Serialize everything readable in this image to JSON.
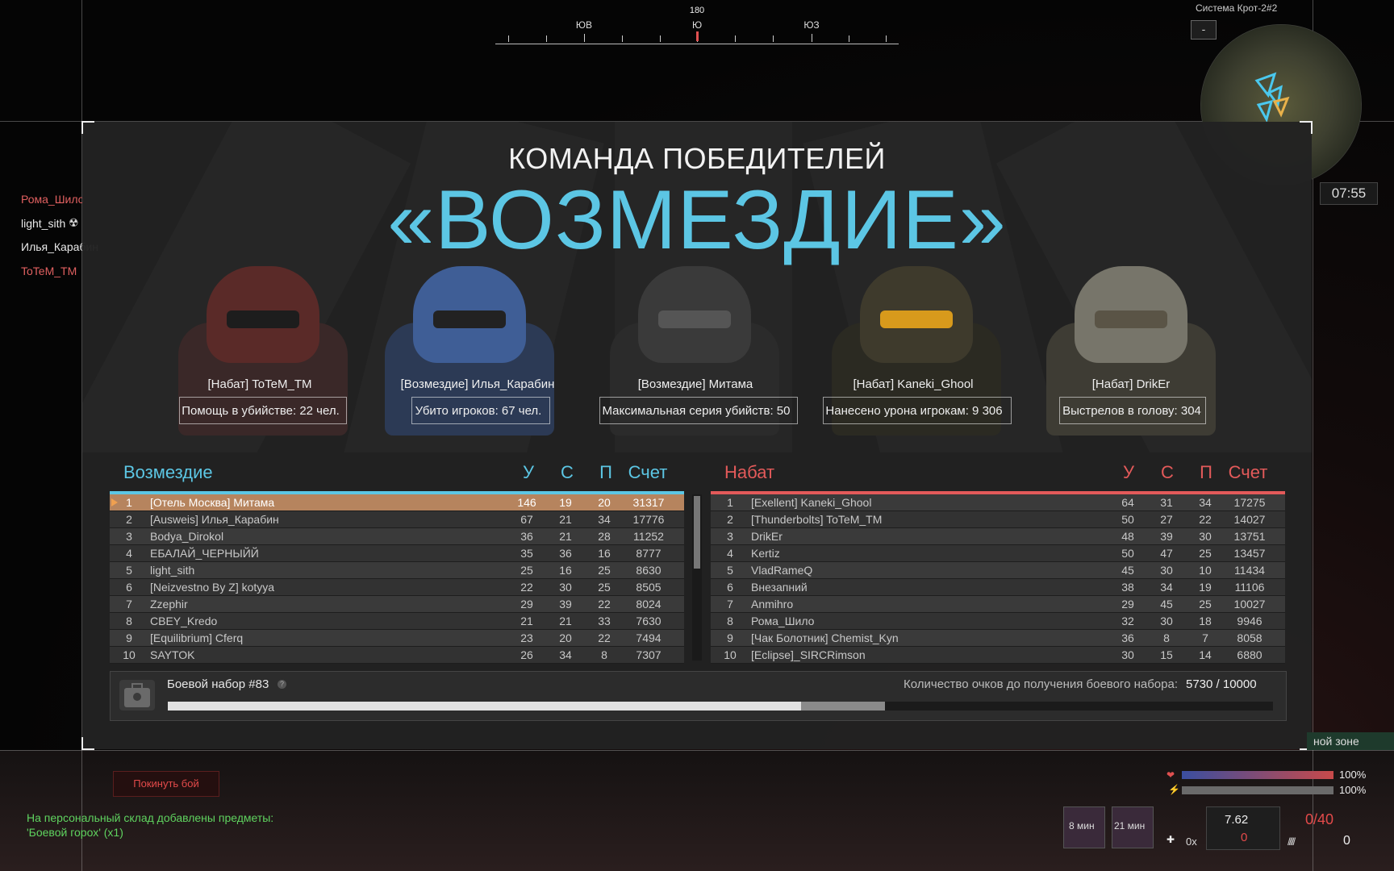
{
  "compass": {
    "degree": "180",
    "labels": [
      {
        "text": "ЮВ"
      },
      {
        "text": "Ю"
      },
      {
        "text": "ЮЗ"
      }
    ]
  },
  "minimap": {
    "title": "Система Крот-2#2",
    "zoom_label": "-",
    "clock": "07:55"
  },
  "kill_feed": [
    {
      "name": "Рома_Шило",
      "color": "#e06060"
    },
    {
      "name": "light_sith",
      "color": "#e8e8e8"
    },
    {
      "name": "Илья_Карабин",
      "color": "#e8e8e8"
    },
    {
      "name": "ToTeM_TM",
      "color": "#e06060"
    }
  ],
  "header": {
    "subtitle": "КОМАНДА ПОБЕДИТЕЛЕЙ",
    "title": "«ВОЗМЕЗДИЕ»"
  },
  "heroes": [
    {
      "name": "[Набат] ToTeM_TM",
      "stat": "Помощь в убийстве: 22 чел."
    },
    {
      "name": "[Возмездие] Илья_Карабин",
      "stat": "Убито игроков: 67 чел."
    },
    {
      "name": "[Возмездие] Митама",
      "stat": "Максимальная серия убийств: 50"
    },
    {
      "name": "[Набат] Kaneki_Ghool",
      "stat": "Нанесено урона игрокам: 9 306"
    },
    {
      "name": "[Набат] DrikEr",
      "stat": "Выстрелов в голову: 304"
    }
  ],
  "columns": {
    "u": "У",
    "s": "С",
    "p": "П",
    "score": "Счет"
  },
  "team_left": {
    "name": "Возмездие",
    "color": "#5cc6e4",
    "rows": [
      {
        "rank": "1",
        "name": "[Отель Москва] Митама",
        "u": "146",
        "s": "19",
        "p": "20",
        "score": "31317"
      },
      {
        "rank": "2",
        "name": "[Ausweis] Илья_Карабин",
        "u": "67",
        "s": "21",
        "p": "34",
        "score": "17776"
      },
      {
        "rank": "3",
        "name": "Bodya_Dirokol",
        "u": "36",
        "s": "21",
        "p": "28",
        "score": "11252"
      },
      {
        "rank": "4",
        "name": "ЕБАЛАЙ_ЧЕРНЫЙЙ",
        "u": "35",
        "s": "36",
        "p": "16",
        "score": "8777"
      },
      {
        "rank": "5",
        "name": "light_sith",
        "u": "25",
        "s": "16",
        "p": "25",
        "score": "8630"
      },
      {
        "rank": "6",
        "name": "[Neizvestno By Z] kotyya",
        "u": "22",
        "s": "30",
        "p": "25",
        "score": "8505"
      },
      {
        "rank": "7",
        "name": "Zzephir",
        "u": "29",
        "s": "39",
        "p": "22",
        "score": "8024"
      },
      {
        "rank": "8",
        "name": "CBEY_Kredo",
        "u": "21",
        "s": "21",
        "p": "33",
        "score": "7630"
      },
      {
        "rank": "9",
        "name": "[Equilibrium] Cferq",
        "u": "23",
        "s": "20",
        "p": "22",
        "score": "7494"
      },
      {
        "rank": "10",
        "name": "SAYTOK",
        "u": "26",
        "s": "34",
        "p": "8",
        "score": "7307"
      }
    ]
  },
  "team_right": {
    "name": "Набат",
    "color": "#e35a5a",
    "rows": [
      {
        "rank": "1",
        "name": "[Exellent] Kaneki_Ghool",
        "u": "64",
        "s": "31",
        "p": "34",
        "score": "17275"
      },
      {
        "rank": "2",
        "name": "[Thunderbolts] ToTeM_TM",
        "u": "50",
        "s": "27",
        "p": "22",
        "score": "14027"
      },
      {
        "rank": "3",
        "name": "DrikEr",
        "u": "48",
        "s": "39",
        "p": "30",
        "score": "13751"
      },
      {
        "rank": "4",
        "name": "Kertiz",
        "u": "50",
        "s": "47",
        "p": "25",
        "score": "13457"
      },
      {
        "rank": "5",
        "name": "VladRameQ",
        "u": "45",
        "s": "30",
        "p": "10",
        "score": "11434"
      },
      {
        "rank": "6",
        "name": "Внезапний",
        "u": "38",
        "s": "34",
        "p": "19",
        "score": "11106"
      },
      {
        "rank": "7",
        "name": "Anmihro",
        "u": "29",
        "s": "45",
        "p": "25",
        "score": "10027"
      },
      {
        "rank": "8",
        "name": "Рома_Шило",
        "u": "32",
        "s": "30",
        "p": "18",
        "score": "9946"
      },
      {
        "rank": "9",
        "name": "[Чак Болотник] Chemist_Kyn",
        "u": "36",
        "s": "8",
        "p": "7",
        "score": "8058"
      },
      {
        "rank": "10",
        "name": "[Eclipse]_SIRCRimson",
        "u": "30",
        "s": "15",
        "p": "14",
        "score": "6880"
      }
    ]
  },
  "kit": {
    "label": "Боевой набор #83",
    "help": "?",
    "requirement_label": "Количество очков до получения боевого набора:",
    "value": "5730 / 10000",
    "progress": 0.573,
    "progress_pending": 0.076
  },
  "hud": {
    "leave_button": "Покинуть бой",
    "notify_line1": "На персональный склад добавлены предметы:",
    "notify_line2": "'Боевой горох' (x1)",
    "zone": "ной зоне",
    "health_pct": "100%",
    "energy_pct": "100%",
    "health": 1.0,
    "energy": 1.0,
    "slot1_time": "8 мин",
    "slot2_time": "21 мин",
    "caliber": "7.62",
    "reserve": "0",
    "magazine": "0/40",
    "grenades": "0",
    "medkits": "0x"
  }
}
